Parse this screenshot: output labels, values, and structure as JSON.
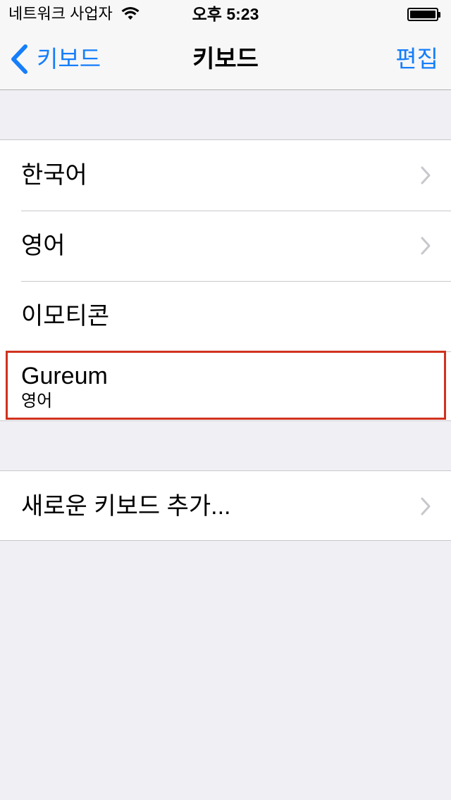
{
  "status_bar": {
    "carrier": "네트워크 사업자",
    "time": "오후 5:23",
    "battery_percent": 100
  },
  "nav": {
    "back_label": "키보드",
    "title": "키보드",
    "edit_label": "편집"
  },
  "keyboards": [
    {
      "label": "한국어",
      "has_chevron": true
    },
    {
      "label": "영어",
      "has_chevron": true
    },
    {
      "label": "이모티콘",
      "has_chevron": false
    },
    {
      "label": "Gureum",
      "subtitle": "영어",
      "has_chevron": false,
      "highlighted": true
    }
  ],
  "add_keyboard": {
    "label": "새로운 키보드 추가..."
  },
  "colors": {
    "accent": "#157efb",
    "highlight_border": "#d0321e",
    "background": "#efeff4",
    "separator": "#c8c7cc"
  },
  "icons": [
    "wifi-icon",
    "battery-icon",
    "back-chevron-icon",
    "disclosure-chevron-icon"
  ]
}
